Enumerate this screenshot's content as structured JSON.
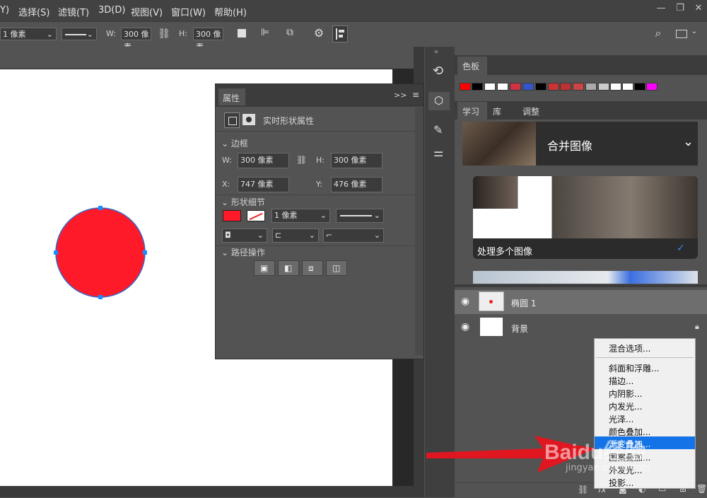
{
  "menu": {
    "items": [
      "Y)",
      "选择(S)",
      "滤镜(T)",
      "3D(D)",
      "视图(V)",
      "窗口(W)",
      "帮助(H)"
    ]
  },
  "window_controls": {
    "minimize": "—",
    "restore": "❐",
    "close": "✕"
  },
  "options_bar": {
    "stroke_width": "1 像素",
    "w_label": "W:",
    "w_value": "300 像素",
    "h_label": "H:",
    "h_value": "300 像素"
  },
  "properties_panel": {
    "title": "属性",
    "subtitle": "实时形状属性",
    "section_bounds": "边框",
    "w_label": "W:",
    "w_value": "300 像素",
    "h_label": "H:",
    "h_value": "300 像素",
    "x_label": "X:",
    "x_value": "747 像素",
    "y_label": "Y:",
    "y_value": "476 像素",
    "section_shape": "形状细节",
    "stroke_size": "1 像素",
    "fill_color": "#ff1a2a",
    "section_path": "路径操作"
  },
  "swatches_panel": {
    "title": "色板",
    "colors": [
      "#ff0000",
      "#000000",
      "#ffffff",
      "#ffffff",
      "#cc3344",
      "#3355cc",
      "#000000",
      "#cc3333",
      "#bb3333",
      "#cc4444",
      "#aaaaaa",
      "#cccccc",
      "#ffffff",
      "#ffffff",
      "#000000",
      "#ff00ff"
    ]
  },
  "learn_panel": {
    "tabs": [
      "学习",
      "库",
      "调整"
    ],
    "header_title": "合并图像",
    "card_title": "处理多个图像"
  },
  "layers": [
    {
      "name": "椭圆 1"
    },
    {
      "name": "背景"
    }
  ],
  "context_menu": {
    "items": [
      "混合选项...",
      "斜面和浮雕...",
      "描边...",
      "内阴影...",
      "内发光...",
      "光泽...",
      "颜色叠加...",
      "渐变叠加...",
      "图案叠加...",
      "外发光...",
      "投影..."
    ],
    "highlighted_index": 7
  },
  "watermark": {
    "brand": "Baidu经验",
    "url": "jingyan.baidu.com"
  },
  "colors": {
    "accent_blue": "#1473e6",
    "circle_red": "#ff1a2a"
  }
}
